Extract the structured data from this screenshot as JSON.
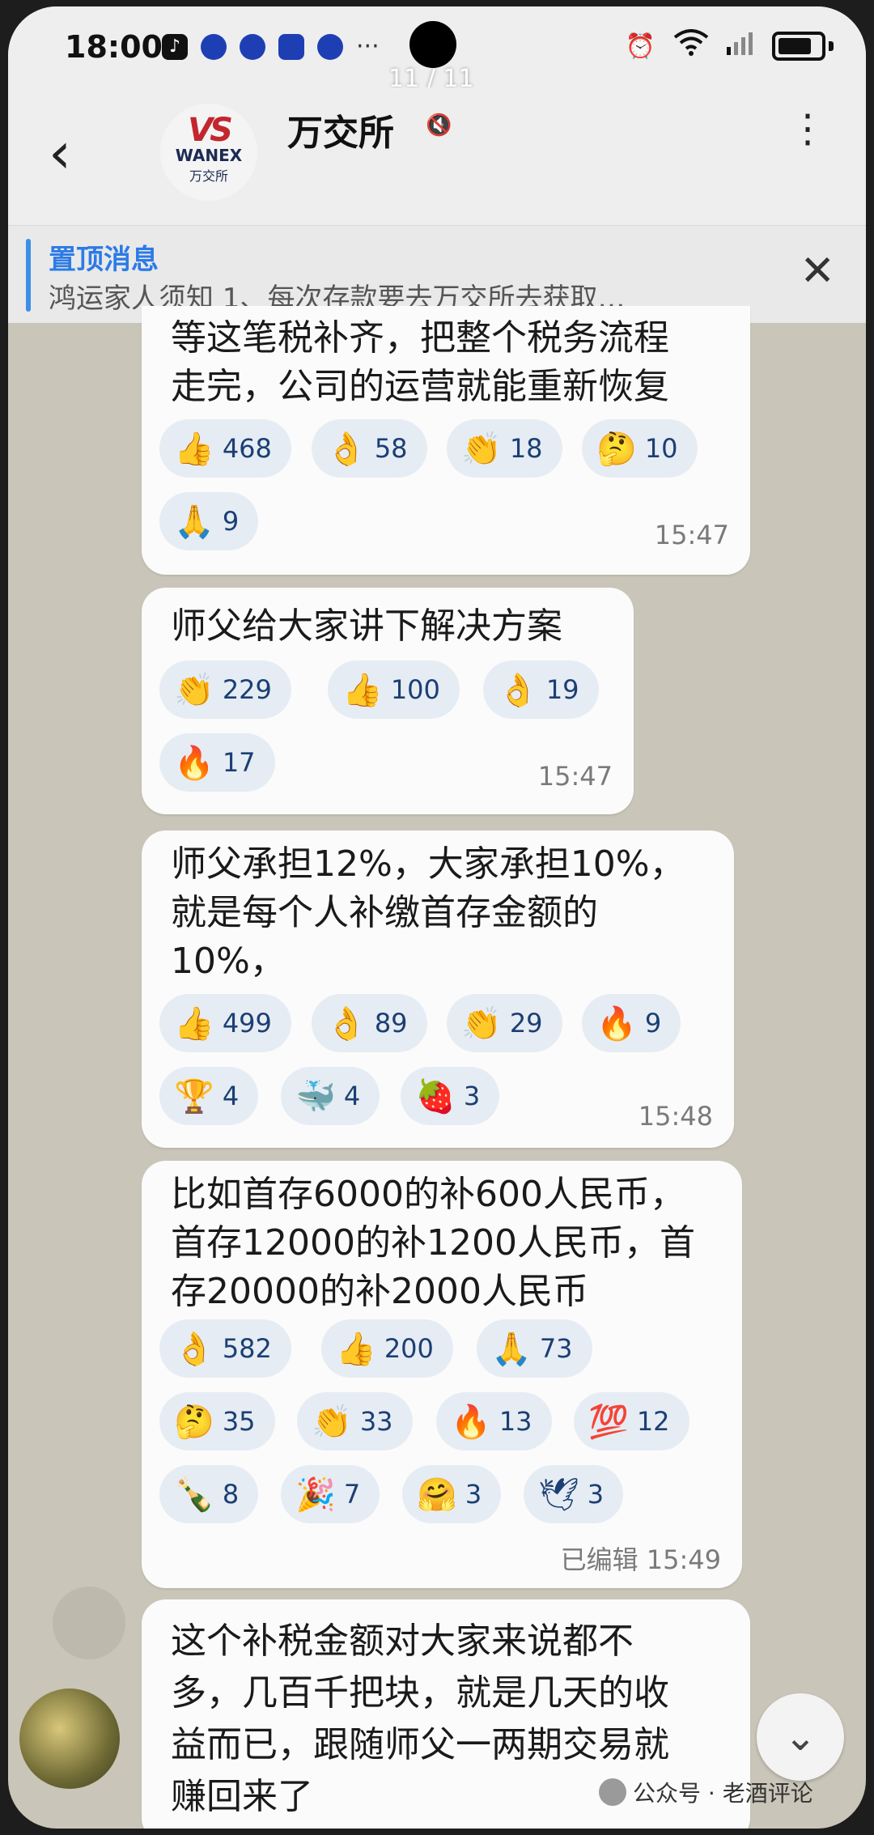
{
  "status_bar": {
    "time": "18:00",
    "dots": "···",
    "pager": "11 / 11",
    "alarm_icon": "⏰",
    "signal": "6",
    "wifi_icon": "wifi-icon"
  },
  "header": {
    "back_icon": "‹",
    "logo_mark": "VS",
    "logo_en": "WANEX",
    "logo_cn": "万交所",
    "title": "万交所",
    "mute_icon": "🔇",
    "menu_icon": "⋮"
  },
  "pinned": {
    "title": "置顶消息",
    "text": "鸿运家人须知  1、每次存款要去万交所去获取…",
    "close_icon": "✕"
  },
  "messages": [
    {
      "text": "等这笔税补齐，把整个税务流程\n走完，公司的运营就能重新恢复",
      "reactions": [
        {
          "emoji": "👍",
          "count": "468"
        },
        {
          "emoji": "👌",
          "count": "58"
        },
        {
          "emoji": "👏",
          "count": "18"
        },
        {
          "emoji": "🤔",
          "count": "10"
        },
        {
          "emoji": "🙏",
          "count": "9"
        }
      ],
      "time": "15:47"
    },
    {
      "text": "师父给大家讲下解决方案",
      "reactions": [
        {
          "emoji": "👏",
          "count": "229"
        },
        {
          "emoji": "👍",
          "count": "100"
        },
        {
          "emoji": "👌",
          "count": "19"
        },
        {
          "emoji": "🔥",
          "count": "17"
        }
      ],
      "time": "15:47"
    },
    {
      "text": "师父承担12%，大家承担10%，\n就是每个人补缴首存金额的\n10%，",
      "reactions": [
        {
          "emoji": "👍",
          "count": "499"
        },
        {
          "emoji": "👌",
          "count": "89"
        },
        {
          "emoji": "👏",
          "count": "29"
        },
        {
          "emoji": "🔥",
          "count": "9"
        },
        {
          "emoji": "🏆",
          "count": "4"
        },
        {
          "emoji": "🐳",
          "count": "4"
        },
        {
          "emoji": "🍓",
          "count": "3"
        }
      ],
      "time": "15:48"
    },
    {
      "text": "比如首存6000的补600人民币，\n首存12000的补1200人民币，首\n存20000的补2000人民币",
      "reactions": [
        {
          "emoji": "👌",
          "count": "582"
        },
        {
          "emoji": "👍",
          "count": "200"
        },
        {
          "emoji": "🙏",
          "count": "73"
        },
        {
          "emoji": "🤔",
          "count": "35"
        },
        {
          "emoji": "👏",
          "count": "33"
        },
        {
          "emoji": "🔥",
          "count": "13"
        },
        {
          "emoji": "💯",
          "count": "12"
        },
        {
          "emoji": "🍾",
          "count": "8"
        },
        {
          "emoji": "🎉",
          "count": "7"
        },
        {
          "emoji": "🤗",
          "count": "3"
        },
        {
          "emoji": "🕊",
          "count": "3"
        }
      ],
      "time": "已编辑 15:49"
    },
    {
      "text": "这个补税金额对大家来说都不\n多，几百千把块，就是几天的收\n益而已，跟随师父一两期交易就\n赚回来了"
    }
  ],
  "scroll_down_icon": "⌄",
  "watermark": "公众号 · 老酒评论"
}
